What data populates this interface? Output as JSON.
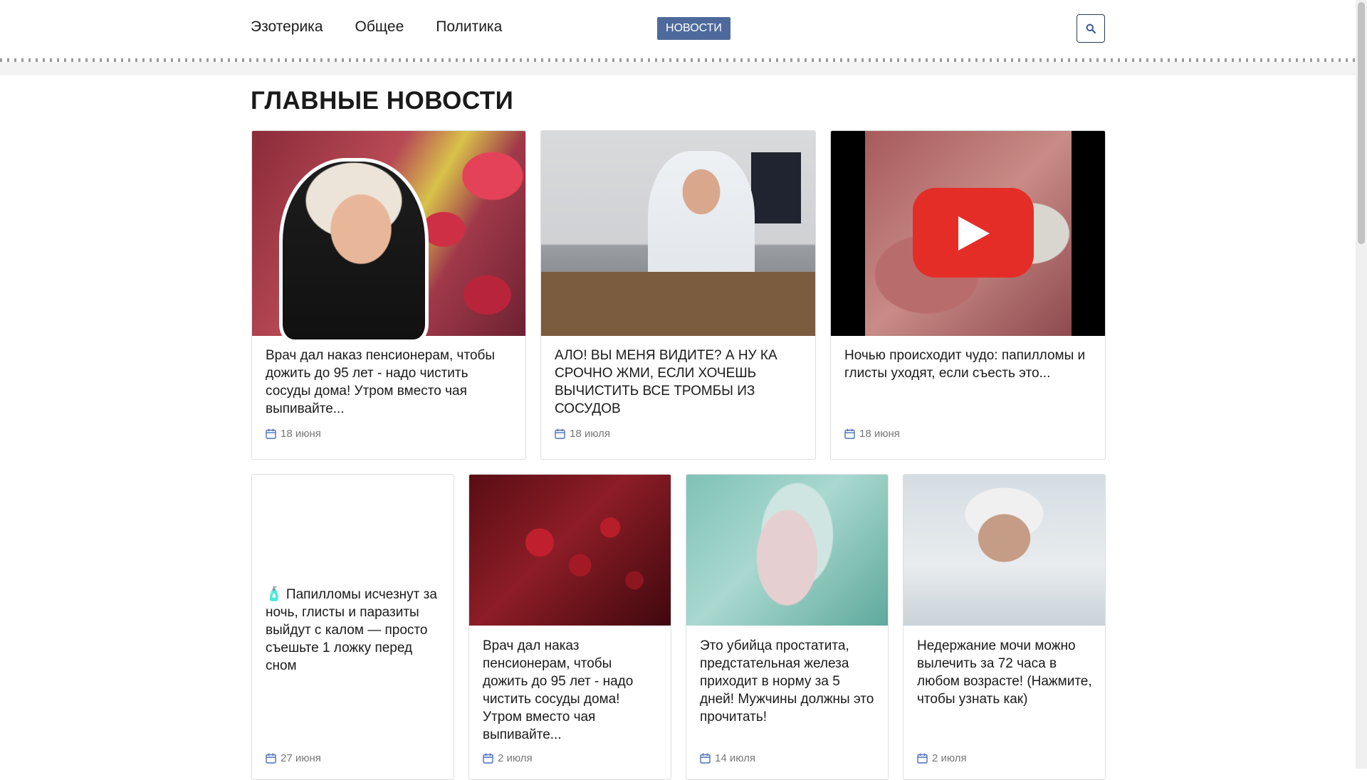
{
  "nav": {
    "items": [
      "Эзотерика",
      "Общее",
      "Политика"
    ],
    "news_button": "НОВОСТИ"
  },
  "section_title": "ГЛАВНЫЕ НОВОСТИ",
  "cards": [
    {
      "title": "Врач дал наказ пенсионерам, чтобы дожить до 95 лет - надо чистить сосуды дома! Утром вместо чая выпивайте...",
      "date": "18 июня"
    },
    {
      "title": "АЛО! ВЫ МЕНЯ ВИДИТЕ? А НУ КА СРОЧНО ЖМИ, ЕСЛИ ХОЧЕШЬ ВЫЧИСТИТЬ ВСЕ ТРОМБЫ ИЗ СОСУДОВ",
      "date": "18 июля"
    },
    {
      "title": "Ночью происходит чудо: папилломы и глисты уходят, если съесть это...",
      "date": "18 июня"
    },
    {
      "title": "🧴 Папилломы исчезнут за ночь, глисты и паразиты выйдут с калом — просто съешьте 1 ложку перед сном",
      "date": "27 июня"
    },
    {
      "title": "Врач дал наказ пенсионерам, чтобы дожить до 95 лет - надо чистить сосуды дома! Утром вместо чая выпивайте...",
      "date": "2 июля"
    },
    {
      "title": "Это убийца простатита, предстательная железа приходит в норму за 5 дней! Мужчины должны это прочитать!",
      "date": "14 июля"
    },
    {
      "title": "Недержание мочи можно вылечить за 72 часа в любом возрасте! (Нажмите, чтобы узнать как)",
      "date": "2 июля"
    }
  ],
  "icons": {
    "search": "search-icon",
    "calendar": "calendar-icon",
    "play": "play-icon"
  },
  "colors": {
    "news_button": "#4e6a9c",
    "youtube": "#e52d27"
  }
}
